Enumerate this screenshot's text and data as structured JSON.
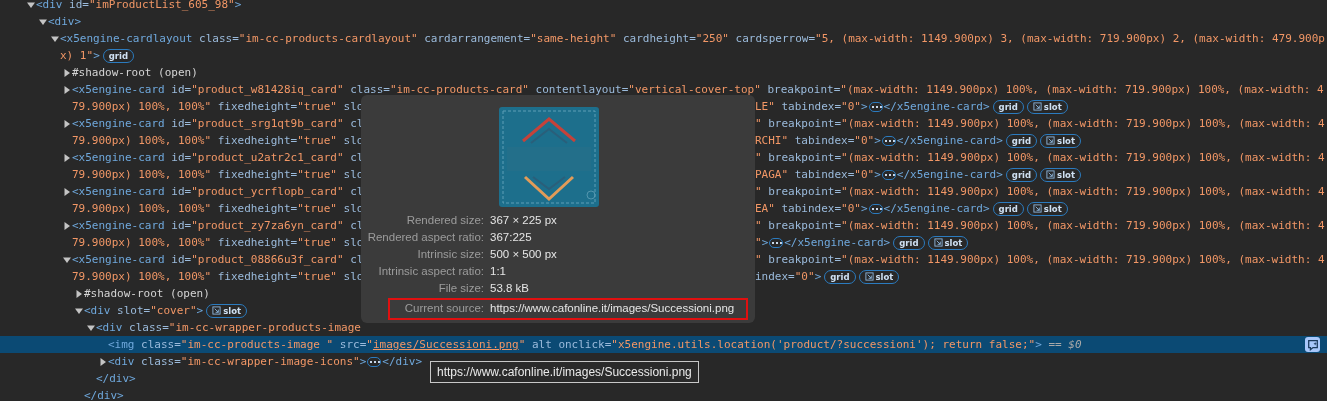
{
  "dom_tree": {
    "selected": false,
    "expanded": true,
    "lines": [
      {
        "start": [
          {
            "kind": "tag",
            "text": "<div"
          },
          {
            "kind": "attr",
            "text": " id="
          },
          {
            "kind": "value",
            "text": "\"imProductList_605_98\""
          },
          {
            "kind": "tag",
            "text": ">"
          }
        ]
      }
    ],
    "children": [
      {
        "selected": false,
        "expanded": true,
        "lines": [
          {
            "start": [
              {
                "kind": "tag",
                "text": "<div>"
              }
            ]
          }
        ],
        "children": [
          {
            "selected": false,
            "expanded": true,
            "lines": [
              {
                "start": [
                  {
                    "kind": "tag",
                    "text": "<x5engine-cardlayout"
                  },
                  {
                    "kind": "attr",
                    "text": " class="
                  },
                  {
                    "kind": "value",
                    "text": "\"im-cc-products-cardlayout\""
                  },
                  {
                    "kind": "attr",
                    "text": " cardarrangement="
                  },
                  {
                    "kind": "value",
                    "text": "\"same-height\""
                  },
                  {
                    "kind": "attr",
                    "text": " cardheight="
                  },
                  {
                    "kind": "value",
                    "text": "\"250\""
                  },
                  {
                    "kind": "attr",
                    "text": " cardsperrow="
                  },
                  {
                    "kind": "value",
                    "text": "\"5, (max-width: 1149.900px) 3, (max-width: 719.900px) 2, (max-width: 479.900p"
                  }
                ]
              },
              {
                "start": [
                  {
                    "kind": "value",
                    "text": "x) 1\""
                  },
                  {
                    "kind": "tag",
                    "text": ">"
                  },
                  {
                    "kind": "badge",
                    "text": "grid"
                  }
                ]
              }
            ],
            "children": [
              {
                "selected": false,
                "expanded": false,
                "lines": [
                  {
                    "start": [
                      {
                        "kind": "text",
                        "text": "#shadow-root (open)"
                      }
                    ]
                  }
                ]
              },
              {
                "selected": false,
                "expanded": false,
                "lines": [
                  {
                    "start": [
                      {
                        "kind": "tag",
                        "text": "<x5engine-card"
                      },
                      {
                        "kind": "attr",
                        "text": " id="
                      },
                      {
                        "kind": "value",
                        "text": "\"product_w81428iq_card\""
                      },
                      {
                        "kind": "attr",
                        "text": " class="
                      },
                      {
                        "kind": "value",
                        "text": "\"im-cc-products-card\""
                      },
                      {
                        "kind": "attr",
                        "text": " contentlayout="
                      },
                      {
                        "kind": "value",
                        "text": "\"vertical-cover-top\""
                      },
                      {
                        "kind": "attr",
                        "text": " breakpoint="
                      },
                      {
                        "kind": "value",
                        "text": "\"(max-width: 1149.900px) 100%, (max-width: 719.900px) 100%, (max-width: 4"
                      }
                    ]
                  },
                  {
                    "start": [
                      {
                        "kind": "value",
                        "text": "79.900px) 100%, 100%\""
                      },
                      {
                        "kind": "attr",
                        "text": " fixedheight="
                      },
                      {
                        "kind": "value",
                        "text": "\"true\""
                      },
                      {
                        "kind": "attr",
                        "text": " slo"
                      }
                    ],
                    "after_popover": [
                      {
                        "kind": "value",
                        "text": "LE\""
                      },
                      {
                        "kind": "attr",
                        "text": " tabindex="
                      },
                      {
                        "kind": "value",
                        "text": "\"0\""
                      },
                      {
                        "kind": "tag",
                        "text": ">"
                      },
                      {
                        "kind": "ellipsis"
                      },
                      {
                        "kind": "tag",
                        "text": "</x5engine-card>"
                      },
                      {
                        "kind": "badge",
                        "text": "grid"
                      },
                      {
                        "kind": "slot_badge",
                        "text": "slot"
                      }
                    ]
                  }
                ]
              },
              {
                "selected": false,
                "expanded": false,
                "lines": [
                  {
                    "start": [
                      {
                        "kind": "tag",
                        "text": "<x5engine-card"
                      },
                      {
                        "kind": "attr",
                        "text": " id="
                      },
                      {
                        "kind": "value",
                        "text": "\"product_srg1qt9b_card\""
                      },
                      {
                        "kind": "attr",
                        "text": " cl"
                      }
                    ],
                    "after_popover": [
                      {
                        "kind": "value",
                        "text": "\""
                      },
                      {
                        "kind": "attr",
                        "text": " breakpoint="
                      },
                      {
                        "kind": "value",
                        "text": "\"(max-width: 1149.900px) 100%, (max-width: 719.900px) 100%, (max-width: 4"
                      }
                    ]
                  },
                  {
                    "start": [
                      {
                        "kind": "value",
                        "text": "79.900px) 100%, 100%\""
                      },
                      {
                        "kind": "attr",
                        "text": " fixedheight="
                      },
                      {
                        "kind": "value",
                        "text": "\"true\""
                      },
                      {
                        "kind": "attr",
                        "text": " slo"
                      }
                    ],
                    "after_popover": [
                      {
                        "kind": "value",
                        "text": "RCHI\""
                      },
                      {
                        "kind": "attr",
                        "text": " tabindex="
                      },
                      {
                        "kind": "value",
                        "text": "\"0\""
                      },
                      {
                        "kind": "tag",
                        "text": ">"
                      },
                      {
                        "kind": "ellipsis"
                      },
                      {
                        "kind": "tag",
                        "text": "</x5engine-card>"
                      },
                      {
                        "kind": "badge",
                        "text": "grid"
                      },
                      {
                        "kind": "slot_badge",
                        "text": "slot"
                      }
                    ]
                  }
                ]
              },
              {
                "selected": false,
                "expanded": false,
                "lines": [
                  {
                    "start": [
                      {
                        "kind": "tag",
                        "text": "<x5engine-card"
                      },
                      {
                        "kind": "attr",
                        "text": " id="
                      },
                      {
                        "kind": "value",
                        "text": "\"product_u2atr2c1_card\""
                      },
                      {
                        "kind": "attr",
                        "text": " cl"
                      }
                    ],
                    "after_popover": [
                      {
                        "kind": "value",
                        "text": "\""
                      },
                      {
                        "kind": "attr",
                        "text": " breakpoint="
                      },
                      {
                        "kind": "value",
                        "text": "\"(max-width: 1149.900px) 100%, (max-width: 719.900px) 100%, (max-width: 4"
                      }
                    ]
                  },
                  {
                    "start": [
                      {
                        "kind": "value",
                        "text": "79.900px) 100%, 100%\""
                      },
                      {
                        "kind": "attr",
                        "text": " fixedheight="
                      },
                      {
                        "kind": "value",
                        "text": "\"true\""
                      },
                      {
                        "kind": "attr",
                        "text": " slo"
                      }
                    ],
                    "after_popover": [
                      {
                        "kind": "value",
                        "text": "PAGA\""
                      },
                      {
                        "kind": "attr",
                        "text": " tabindex="
                      },
                      {
                        "kind": "value",
                        "text": "\"0\""
                      },
                      {
                        "kind": "tag",
                        "text": ">"
                      },
                      {
                        "kind": "ellipsis"
                      },
                      {
                        "kind": "tag",
                        "text": "</x5engine-card>"
                      },
                      {
                        "kind": "badge",
                        "text": "grid"
                      },
                      {
                        "kind": "slot_badge",
                        "text": "slot"
                      }
                    ]
                  }
                ]
              },
              {
                "selected": false,
                "expanded": false,
                "lines": [
                  {
                    "start": [
                      {
                        "kind": "tag",
                        "text": "<x5engine-card"
                      },
                      {
                        "kind": "attr",
                        "text": " id="
                      },
                      {
                        "kind": "value",
                        "text": "\"product_ycrflopb_card\""
                      },
                      {
                        "kind": "attr",
                        "text": " cl"
                      }
                    ],
                    "after_popover": [
                      {
                        "kind": "value",
                        "text": "\""
                      },
                      {
                        "kind": "attr",
                        "text": " breakpoint="
                      },
                      {
                        "kind": "value",
                        "text": "\"(max-width: 1149.900px) 100%, (max-width: 719.900px) 100%, (max-width: 4"
                      }
                    ]
                  },
                  {
                    "start": [
                      {
                        "kind": "value",
                        "text": "79.900px) 100%, 100%\""
                      },
                      {
                        "kind": "attr",
                        "text": " fixedheight="
                      },
                      {
                        "kind": "value",
                        "text": "\"true\""
                      },
                      {
                        "kind": "attr",
                        "text": " slo"
                      }
                    ],
                    "after_popover": [
                      {
                        "kind": "value",
                        "text": "EA\""
                      },
                      {
                        "kind": "attr",
                        "text": " tabindex="
                      },
                      {
                        "kind": "value",
                        "text": "\"0\""
                      },
                      {
                        "kind": "tag",
                        "text": ">"
                      },
                      {
                        "kind": "ellipsis"
                      },
                      {
                        "kind": "tag",
                        "text": "</x5engine-card>"
                      },
                      {
                        "kind": "badge",
                        "text": "grid"
                      },
                      {
                        "kind": "slot_badge",
                        "text": "slot"
                      }
                    ]
                  }
                ]
              },
              {
                "selected": false,
                "expanded": false,
                "lines": [
                  {
                    "start": [
                      {
                        "kind": "tag",
                        "text": "<x5engine-card"
                      },
                      {
                        "kind": "attr",
                        "text": " id="
                      },
                      {
                        "kind": "value",
                        "text": "\"product_zy7za6yn_card\""
                      },
                      {
                        "kind": "attr",
                        "text": " cl"
                      }
                    ],
                    "after_popover": [
                      {
                        "kind": "value",
                        "text": "\""
                      },
                      {
                        "kind": "attr",
                        "text": " breakpoint="
                      },
                      {
                        "kind": "value",
                        "text": "\"(max-width: 1149.900px) 100%, (max-width: 719.900px) 100%, (max-width: 4"
                      }
                    ]
                  },
                  {
                    "start": [
                      {
                        "kind": "value",
                        "text": "79.900px) 100%, 100%\""
                      },
                      {
                        "kind": "attr",
                        "text": " fixedheight="
                      },
                      {
                        "kind": "value",
                        "text": "\"true\""
                      },
                      {
                        "kind": "attr",
                        "text": " slo"
                      }
                    ],
                    "after_popover": [
                      {
                        "kind": "value",
                        "text": "\""
                      },
                      {
                        "kind": "tag",
                        "text": ">"
                      },
                      {
                        "kind": "ellipsis"
                      },
                      {
                        "kind": "tag",
                        "text": "</x5engine-card>"
                      },
                      {
                        "kind": "badge",
                        "text": "grid"
                      },
                      {
                        "kind": "slot_badge",
                        "text": "slot"
                      }
                    ]
                  }
                ]
              },
              {
                "selected": false,
                "expanded": true,
                "lines": [
                  {
                    "start": [
                      {
                        "kind": "tag",
                        "text": "<x5engine-card"
                      },
                      {
                        "kind": "attr",
                        "text": " id="
                      },
                      {
                        "kind": "value",
                        "text": "\"product_08866u3f_card\""
                      },
                      {
                        "kind": "attr",
                        "text": " cl"
                      }
                    ],
                    "after_popover": [
                      {
                        "kind": "value",
                        "text": "\""
                      },
                      {
                        "kind": "attr",
                        "text": " breakpoint="
                      },
                      {
                        "kind": "value",
                        "text": "\"(max-width: 1149.900px) 100%, (max-width: 719.900px) 100%, (max-width: 4"
                      }
                    ]
                  },
                  {
                    "start": [
                      {
                        "kind": "value",
                        "text": "79.900px) 100%, 100%\""
                      },
                      {
                        "kind": "attr",
                        "text": " fixedheight="
                      },
                      {
                        "kind": "value",
                        "text": "\"true\""
                      },
                      {
                        "kind": "attr",
                        "text": " slo"
                      }
                    ],
                    "after_popover": [
                      {
                        "kind": "attr",
                        "text": "index="
                      },
                      {
                        "kind": "value",
                        "text": "\"0\""
                      },
                      {
                        "kind": "tag",
                        "text": ">"
                      },
                      {
                        "kind": "badge",
                        "text": "grid"
                      },
                      {
                        "kind": "slot_badge",
                        "text": "slot"
                      }
                    ]
                  }
                ],
                "children": [
                  {
                    "selected": false,
                    "expanded": false,
                    "lines": [
                      {
                        "start": [
                          {
                            "kind": "text",
                            "text": "#shadow-root (open)"
                          }
                        ]
                      }
                    ]
                  },
                  {
                    "selected": false,
                    "expanded": true,
                    "lines": [
                      {
                        "start": [
                          {
                            "kind": "tag",
                            "text": "<div"
                          },
                          {
                            "kind": "attr",
                            "text": " slot="
                          },
                          {
                            "kind": "value",
                            "text": "\"cover\""
                          },
                          {
                            "kind": "tag",
                            "text": ">"
                          },
                          {
                            "kind": "slot_badge",
                            "text": "slot"
                          }
                        ]
                      }
                    ],
                    "children": [
                      {
                        "selected": false,
                        "expanded": true,
                        "lines": [
                          {
                            "start": [
                              {
                                "kind": "tag",
                                "text": "<div"
                              },
                              {
                                "kind": "attr",
                                "text": " class="
                              },
                              {
                                "kind": "value",
                                "text": "\"im-cc-wrapper-products-image"
                              }
                            ]
                          }
                        ],
                        "children": [
                          {
                            "selected": true,
                            "lines": [
                              {
                                "start": [
                                  {
                                    "kind": "tag",
                                    "text": "<img"
                                  },
                                  {
                                    "kind": "attr",
                                    "text": " class="
                                  },
                                  {
                                    "kind": "value",
                                    "text": "\"im-cc-products-image \""
                                  },
                                  {
                                    "kind": "attr",
                                    "text": " src="
                                  },
                                  {
                                    "kind": "value",
                                    "text": "\""
                                  },
                                  {
                                    "kind": "link",
                                    "text": "images/Successioni.png"
                                  },
                                  {
                                    "kind": "value",
                                    "text": "\""
                                  },
                                  {
                                    "kind": "attr",
                                    "text": " alt onclick="
                                  },
                                  {
                                    "kind": "value",
                                    "text": "\"x5engine.utils.location('product/?successioni'); return false;\""
                                  },
                                  {
                                    "kind": "tag",
                                    "text": ">"
                                  },
                                  {
                                    "kind": "ref",
                                    "text": " == $0"
                                  }
                                ]
                              }
                            ]
                          },
                          {
                            "selected": false,
                            "expanded": false,
                            "lines": [
                              {
                                "start": [
                                  {
                                    "kind": "tag",
                                    "text": "<div"
                                  },
                                  {
                                    "kind": "attr",
                                    "text": " class="
                                  },
                                  {
                                    "kind": "value",
                                    "text": "\"im-cc-wrapper-image-icons\""
                                  },
                                  {
                                    "kind": "tag",
                                    "text": ">"
                                  },
                                  {
                                    "kind": "ellipsis"
                                  },
                                  {
                                    "kind": "tag",
                                    "text": "</div>"
                                  }
                                ]
                              }
                            ]
                          }
                        ],
                        "closing": [
                          {
                            "kind": "tag",
                            "text": "</div>"
                          }
                        ]
                      }
                    ],
                    "closing": [
                      {
                        "kind": "tag",
                        "text": "</div>"
                      }
                    ]
                  }
                ]
              }
            ]
          }
        ]
      }
    ]
  },
  "image_popover": {
    "rows": [
      {
        "label": "Rendered size:",
        "value": "367 × 225 px",
        "highlighted": false
      },
      {
        "label": "Rendered aspect ratio:",
        "value": "367:225",
        "highlighted": false
      },
      {
        "label": "Intrinsic size:",
        "value": "500 × 500 px",
        "highlighted": false
      },
      {
        "label": "Intrinsic aspect ratio:",
        "value": "1:1",
        "highlighted": false
      },
      {
        "label": "File size:",
        "value": "53.8 kB",
        "highlighted": false
      },
      {
        "label": "Current source:",
        "value": "https://www.cafonline.it/images/Successioni.png",
        "highlighted": true
      }
    ]
  },
  "tooltip": {
    "text": "https://www.cafonline.it/images/Successioni.png"
  }
}
